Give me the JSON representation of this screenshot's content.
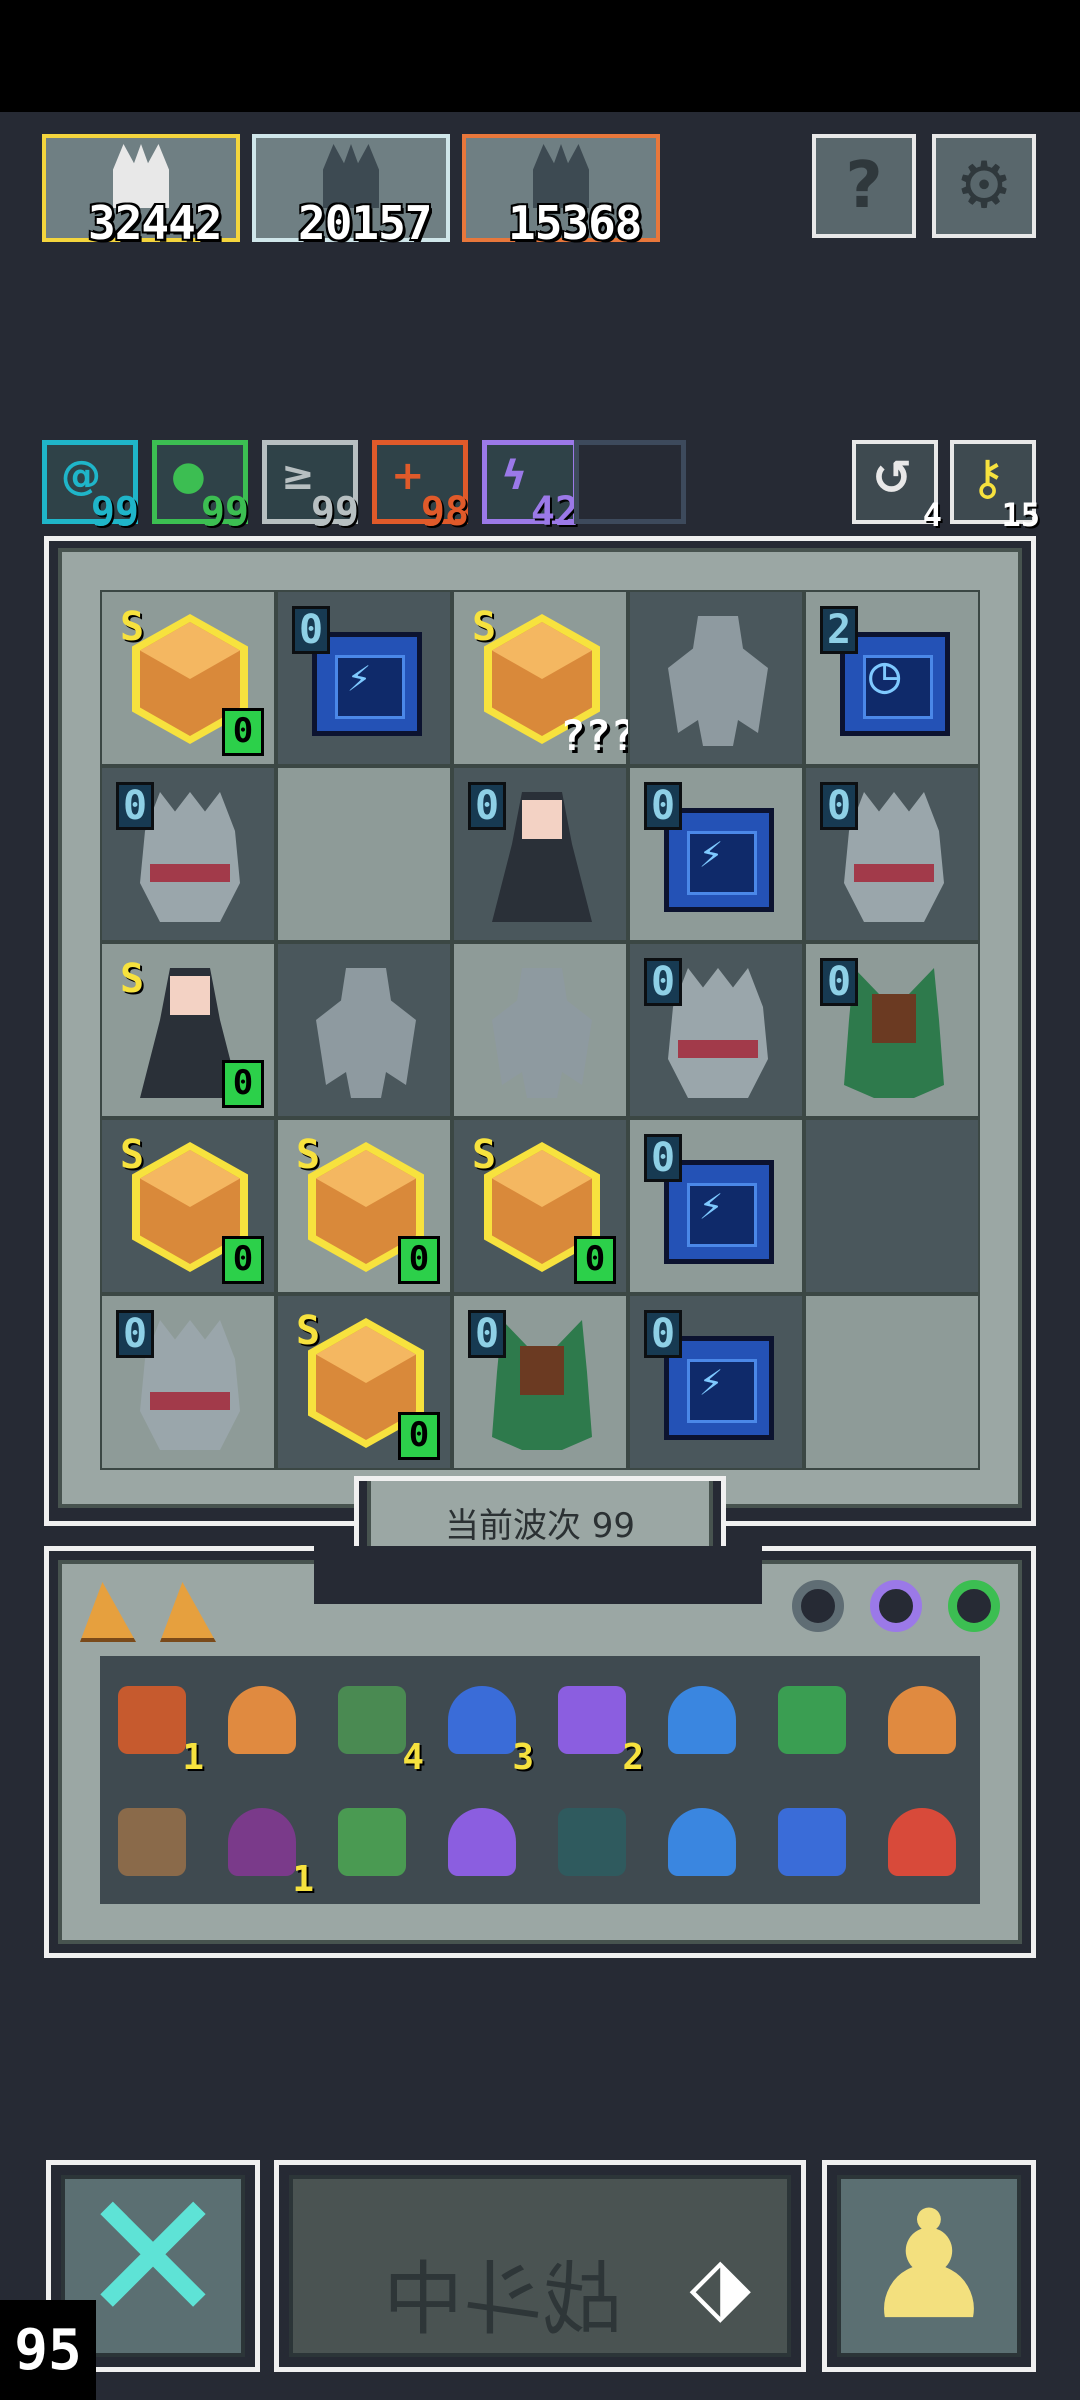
{
  "scores": [
    "32442",
    "20157",
    "15368"
  ],
  "score_card_colors": [
    "#f4d53d",
    "#cfe6ea",
    "#e8773b"
  ],
  "top_buttons": {
    "help": "?",
    "settings": "⚙"
  },
  "resources": [
    {
      "icon": "spiral-icon",
      "symbol": "@",
      "count": "99",
      "color": "#1fb5c9"
    },
    {
      "icon": "leaf-icon",
      "symbol": "●",
      "count": "99",
      "color": "#3cbe52"
    },
    {
      "icon": "wing-icon",
      "symbol": "≥",
      "count": "99",
      "color": "#b7bfc1"
    },
    {
      "icon": "fire-icon",
      "symbol": "+",
      "count": "98",
      "color": "#e05a2a"
    },
    {
      "icon": "lightning-icon",
      "symbol": "ϟ",
      "count": "42",
      "color": "#9b79e8"
    }
  ],
  "side_buttons": [
    {
      "icon": "refresh-icon",
      "symbol": "↺",
      "count": "4"
    },
    {
      "icon": "key-icon",
      "symbol": "⚷",
      "count": "15"
    }
  ],
  "board": [
    [
      {
        "kind": "gem",
        "lvl": "S",
        "sub": "0"
      },
      {
        "kind": "tower",
        "lvl": "0"
      },
      {
        "kind": "gem",
        "lvl": "S",
        "q": "???"
      },
      {
        "kind": "stone",
        "lvl": ""
      },
      {
        "kind": "clock",
        "lvl": "2"
      }
    ],
    [
      {
        "kind": "knight",
        "lvl": "0"
      },
      {
        "kind": "empty",
        "lvl": ""
      },
      {
        "kind": "witch",
        "lvl": "0"
      },
      {
        "kind": "tower",
        "lvl": "0"
      },
      {
        "kind": "knight",
        "lvl": "0"
      }
    ],
    [
      {
        "kind": "witch",
        "lvl": "S",
        "sub": "0"
      },
      {
        "kind": "stone",
        "lvl": ""
      },
      {
        "kind": "stone",
        "lvl": ""
      },
      {
        "kind": "knight",
        "lvl": "0"
      },
      {
        "kind": "ogre",
        "lvl": "0"
      }
    ],
    [
      {
        "kind": "gem",
        "lvl": "S",
        "sub": "0"
      },
      {
        "kind": "gem",
        "lvl": "S",
        "sub": "0"
      },
      {
        "kind": "gem",
        "lvl": "S",
        "sub": "0"
      },
      {
        "kind": "tower",
        "lvl": "0"
      },
      {
        "kind": "empty",
        "lvl": ""
      }
    ],
    [
      {
        "kind": "knight",
        "lvl": "0"
      },
      {
        "kind": "gem",
        "lvl": "S",
        "sub": "0"
      },
      {
        "kind": "ogre",
        "lvl": "0"
      },
      {
        "kind": "tower",
        "lvl": "0"
      },
      {
        "kind": "empty",
        "lvl": ""
      }
    ]
  ],
  "wave_label": "当前波次 99",
  "inventory_rows": [
    [
      {
        "icon": "lantern-icon",
        "color": "#c65a2e",
        "count": "1"
      },
      {
        "icon": "armor-icon",
        "color": "#e08a40",
        "count": ""
      },
      {
        "icon": "hood-icon",
        "color": "#4a8a52",
        "count": "4"
      },
      {
        "icon": "hourglass-icon",
        "color": "#3a6cd8",
        "count": "3"
      },
      {
        "icon": "potion-icon",
        "color": "#8b5ee0",
        "count": "2"
      },
      {
        "icon": "bird-icon",
        "color": "#3a86e0",
        "count": ""
      },
      {
        "icon": "spear-icon",
        "color": "#3a9e52",
        "count": ""
      },
      {
        "icon": "axe-icon",
        "color": "#e08a40",
        "count": ""
      }
    ],
    [
      {
        "icon": "slingshot-icon",
        "color": "#8a6a4a",
        "count": ""
      },
      {
        "icon": "demon-mask-icon",
        "color": "#7a3a8a",
        "count": "1"
      },
      {
        "icon": "mimic-chest-icon",
        "color": "#4a9a52",
        "count": ""
      },
      {
        "icon": "scepter-icon",
        "color": "#8b5ee0",
        "count": ""
      },
      {
        "icon": "bell-icon",
        "color": "#2f5a5e",
        "count": ""
      },
      {
        "icon": "droplet-icon",
        "color": "#3a86e0",
        "count": ""
      },
      {
        "icon": "water-rune-icon",
        "color": "#3a6cd8",
        "count": ""
      },
      {
        "icon": "arrow-icon",
        "color": "#d84a3a",
        "count": ""
      }
    ]
  ],
  "battle_button_label": "战斗中",
  "fps_counter": "95"
}
